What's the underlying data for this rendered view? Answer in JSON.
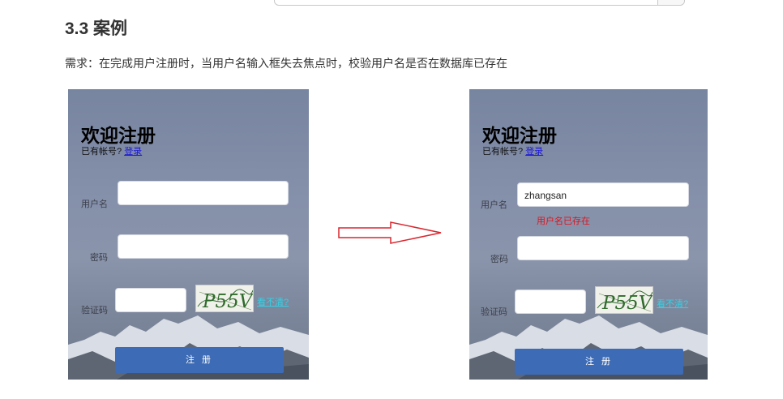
{
  "section": {
    "title": "3.3 案例",
    "requirement": "需求：在完成用户注册时，当用户名输入框失去焦点时，校验用户名是否在数据库已存在"
  },
  "form": {
    "heading": "欢迎注册",
    "has_account": "已有帐号?",
    "login_link": "登录",
    "username_label": "用户名",
    "password_label": "密码",
    "captcha_label": "验证码",
    "captcha_text": "P55V",
    "unclear_link": "看不清?",
    "submit_label": "注 册"
  },
  "right_form": {
    "username_value": "zhangsan",
    "username_error": "用户名已存在"
  },
  "colors": {
    "button": "#3d6bb5",
    "error": "#e0121c",
    "link": "#1a16d8",
    "unclear_link": "#33d2e6",
    "arrow": "#d9272e"
  },
  "icons": {
    "arrow": "right-arrow-icon"
  }
}
